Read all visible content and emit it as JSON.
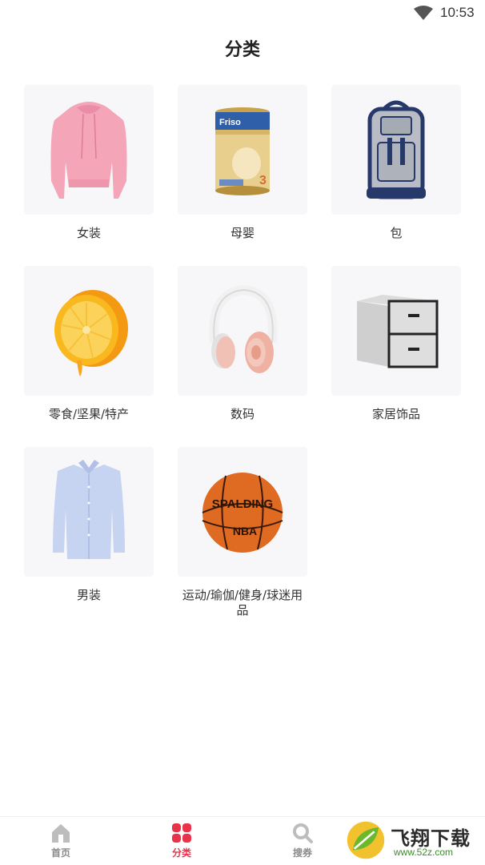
{
  "status_bar": {
    "time": "10:53"
  },
  "header": {
    "title": "分类"
  },
  "categories": [
    {
      "label": "女装",
      "icon": "hoodie-icon"
    },
    {
      "label": "母婴",
      "icon": "formula-can-icon"
    },
    {
      "label": "包",
      "icon": "backpack-icon"
    },
    {
      "label": "零食/坚果/特产",
      "icon": "orange-icon"
    },
    {
      "label": "数码",
      "icon": "headphones-icon"
    },
    {
      "label": "家居饰品",
      "icon": "storage-box-icon"
    },
    {
      "label": "男装",
      "icon": "shirt-icon"
    },
    {
      "label": "运动/瑜伽/健身/球迷用品",
      "icon": "basketball-icon"
    }
  ],
  "product_text": {
    "formula_brand": "Friso",
    "basketball_brand": "SPALDING",
    "basketball_league": "NBA"
  },
  "tabbar": {
    "items": [
      {
        "label": "首页",
        "icon": "home-icon",
        "active": false
      },
      {
        "label": "分类",
        "icon": "category-grid-icon",
        "active": true
      },
      {
        "label": "搜券",
        "icon": "search-icon",
        "active": false
      }
    ]
  },
  "watermark": {
    "text": "飞翔下载",
    "url": "www.52z.com"
  },
  "colors": {
    "accent": "#e8334a",
    "inactive": "#8a8a8a",
    "tile_bg": "#f7f7f9"
  }
}
